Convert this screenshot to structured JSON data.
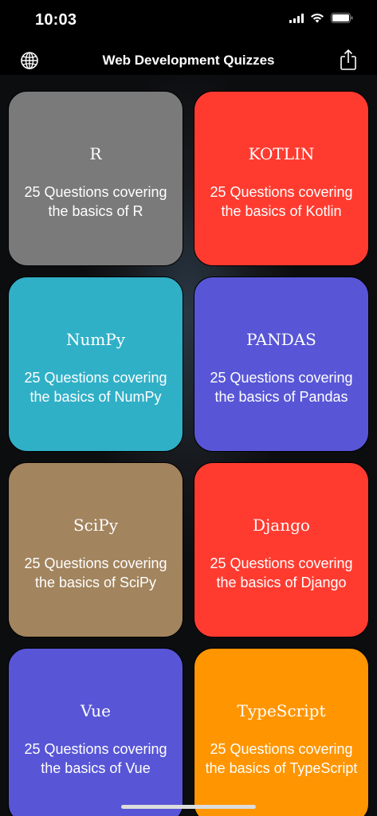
{
  "status_bar": {
    "time": "10:03"
  },
  "nav": {
    "title": "Web Development Quizzes",
    "left_icon": "globe-icon",
    "right_icon": "share-icon"
  },
  "cards": [
    {
      "title": "R",
      "description": "25 Questions covering the basics of R",
      "color": "#7a7a7a"
    },
    {
      "title": "KOTLIN",
      "description": "25 Questions covering the basics of Kotlin",
      "color": "#ff3b30"
    },
    {
      "title": "NumPy",
      "description": "25 Questions covering the basics of NumPy",
      "color": "#30b0c7"
    },
    {
      "title": "PANDAS",
      "description": "25 Questions covering the basics of Pandas",
      "color": "#5856d6"
    },
    {
      "title": "SciPy",
      "description": "25 Questions covering the basics of SciPy",
      "color": "#a2845e"
    },
    {
      "title": "Django",
      "description": "25 Questions covering the basics of Django",
      "color": "#ff3b30"
    },
    {
      "title": "Vue",
      "description": "25 Questions covering the basics of Vue",
      "color": "#5856d6"
    },
    {
      "title": "TypeScript",
      "description": "25 Questions covering the basics of TypeScript",
      "color": "#ff9500"
    }
  ]
}
